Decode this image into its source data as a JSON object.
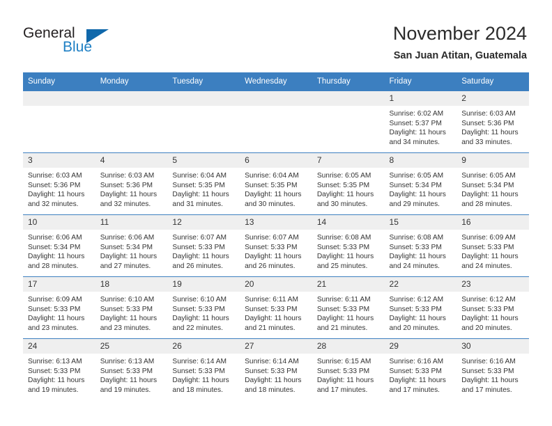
{
  "brand": {
    "name_part1": "General",
    "name_part2": "Blue",
    "flag_icon": "triangle-flag-icon"
  },
  "header": {
    "title": "November 2024",
    "subtitle": "San Juan Atitan, Guatemala"
  },
  "colors": {
    "header_blue": "#3c7fc0",
    "brand_blue": "#1d7fc4",
    "daynum_bg": "#efefef"
  },
  "calendar": {
    "weekday_headers": [
      "Sunday",
      "Monday",
      "Tuesday",
      "Wednesday",
      "Thursday",
      "Friday",
      "Saturday"
    ],
    "weeks": [
      [
        {
          "day": "",
          "empty": true,
          "sunrise": "",
          "sunset": "",
          "daylight1": "",
          "daylight2": ""
        },
        {
          "day": "",
          "empty": true,
          "sunrise": "",
          "sunset": "",
          "daylight1": "",
          "daylight2": ""
        },
        {
          "day": "",
          "empty": true,
          "sunrise": "",
          "sunset": "",
          "daylight1": "",
          "daylight2": ""
        },
        {
          "day": "",
          "empty": true,
          "sunrise": "",
          "sunset": "",
          "daylight1": "",
          "daylight2": ""
        },
        {
          "day": "",
          "empty": true,
          "sunrise": "",
          "sunset": "",
          "daylight1": "",
          "daylight2": ""
        },
        {
          "day": "1",
          "empty": false,
          "sunrise": "Sunrise: 6:02 AM",
          "sunset": "Sunset: 5:37 PM",
          "daylight1": "Daylight: 11 hours",
          "daylight2": "and 34 minutes."
        },
        {
          "day": "2",
          "empty": false,
          "sunrise": "Sunrise: 6:03 AM",
          "sunset": "Sunset: 5:36 PM",
          "daylight1": "Daylight: 11 hours",
          "daylight2": "and 33 minutes."
        }
      ],
      [
        {
          "day": "3",
          "empty": false,
          "sunrise": "Sunrise: 6:03 AM",
          "sunset": "Sunset: 5:36 PM",
          "daylight1": "Daylight: 11 hours",
          "daylight2": "and 32 minutes."
        },
        {
          "day": "4",
          "empty": false,
          "sunrise": "Sunrise: 6:03 AM",
          "sunset": "Sunset: 5:36 PM",
          "daylight1": "Daylight: 11 hours",
          "daylight2": "and 32 minutes."
        },
        {
          "day": "5",
          "empty": false,
          "sunrise": "Sunrise: 6:04 AM",
          "sunset": "Sunset: 5:35 PM",
          "daylight1": "Daylight: 11 hours",
          "daylight2": "and 31 minutes."
        },
        {
          "day": "6",
          "empty": false,
          "sunrise": "Sunrise: 6:04 AM",
          "sunset": "Sunset: 5:35 PM",
          "daylight1": "Daylight: 11 hours",
          "daylight2": "and 30 minutes."
        },
        {
          "day": "7",
          "empty": false,
          "sunrise": "Sunrise: 6:05 AM",
          "sunset": "Sunset: 5:35 PM",
          "daylight1": "Daylight: 11 hours",
          "daylight2": "and 30 minutes."
        },
        {
          "day": "8",
          "empty": false,
          "sunrise": "Sunrise: 6:05 AM",
          "sunset": "Sunset: 5:34 PM",
          "daylight1": "Daylight: 11 hours",
          "daylight2": "and 29 minutes."
        },
        {
          "day": "9",
          "empty": false,
          "sunrise": "Sunrise: 6:05 AM",
          "sunset": "Sunset: 5:34 PM",
          "daylight1": "Daylight: 11 hours",
          "daylight2": "and 28 minutes."
        }
      ],
      [
        {
          "day": "10",
          "empty": false,
          "sunrise": "Sunrise: 6:06 AM",
          "sunset": "Sunset: 5:34 PM",
          "daylight1": "Daylight: 11 hours",
          "daylight2": "and 28 minutes."
        },
        {
          "day": "11",
          "empty": false,
          "sunrise": "Sunrise: 6:06 AM",
          "sunset": "Sunset: 5:34 PM",
          "daylight1": "Daylight: 11 hours",
          "daylight2": "and 27 minutes."
        },
        {
          "day": "12",
          "empty": false,
          "sunrise": "Sunrise: 6:07 AM",
          "sunset": "Sunset: 5:33 PM",
          "daylight1": "Daylight: 11 hours",
          "daylight2": "and 26 minutes."
        },
        {
          "day": "13",
          "empty": false,
          "sunrise": "Sunrise: 6:07 AM",
          "sunset": "Sunset: 5:33 PM",
          "daylight1": "Daylight: 11 hours",
          "daylight2": "and 26 minutes."
        },
        {
          "day": "14",
          "empty": false,
          "sunrise": "Sunrise: 6:08 AM",
          "sunset": "Sunset: 5:33 PM",
          "daylight1": "Daylight: 11 hours",
          "daylight2": "and 25 minutes."
        },
        {
          "day": "15",
          "empty": false,
          "sunrise": "Sunrise: 6:08 AM",
          "sunset": "Sunset: 5:33 PM",
          "daylight1": "Daylight: 11 hours",
          "daylight2": "and 24 minutes."
        },
        {
          "day": "16",
          "empty": false,
          "sunrise": "Sunrise: 6:09 AM",
          "sunset": "Sunset: 5:33 PM",
          "daylight1": "Daylight: 11 hours",
          "daylight2": "and 24 minutes."
        }
      ],
      [
        {
          "day": "17",
          "empty": false,
          "sunrise": "Sunrise: 6:09 AM",
          "sunset": "Sunset: 5:33 PM",
          "daylight1": "Daylight: 11 hours",
          "daylight2": "and 23 minutes."
        },
        {
          "day": "18",
          "empty": false,
          "sunrise": "Sunrise: 6:10 AM",
          "sunset": "Sunset: 5:33 PM",
          "daylight1": "Daylight: 11 hours",
          "daylight2": "and 23 minutes."
        },
        {
          "day": "19",
          "empty": false,
          "sunrise": "Sunrise: 6:10 AM",
          "sunset": "Sunset: 5:33 PM",
          "daylight1": "Daylight: 11 hours",
          "daylight2": "and 22 minutes."
        },
        {
          "day": "20",
          "empty": false,
          "sunrise": "Sunrise: 6:11 AM",
          "sunset": "Sunset: 5:33 PM",
          "daylight1": "Daylight: 11 hours",
          "daylight2": "and 21 minutes."
        },
        {
          "day": "21",
          "empty": false,
          "sunrise": "Sunrise: 6:11 AM",
          "sunset": "Sunset: 5:33 PM",
          "daylight1": "Daylight: 11 hours",
          "daylight2": "and 21 minutes."
        },
        {
          "day": "22",
          "empty": false,
          "sunrise": "Sunrise: 6:12 AM",
          "sunset": "Sunset: 5:33 PM",
          "daylight1": "Daylight: 11 hours",
          "daylight2": "and 20 minutes."
        },
        {
          "day": "23",
          "empty": false,
          "sunrise": "Sunrise: 6:12 AM",
          "sunset": "Sunset: 5:33 PM",
          "daylight1": "Daylight: 11 hours",
          "daylight2": "and 20 minutes."
        }
      ],
      [
        {
          "day": "24",
          "empty": false,
          "sunrise": "Sunrise: 6:13 AM",
          "sunset": "Sunset: 5:33 PM",
          "daylight1": "Daylight: 11 hours",
          "daylight2": "and 19 minutes."
        },
        {
          "day": "25",
          "empty": false,
          "sunrise": "Sunrise: 6:13 AM",
          "sunset": "Sunset: 5:33 PM",
          "daylight1": "Daylight: 11 hours",
          "daylight2": "and 19 minutes."
        },
        {
          "day": "26",
          "empty": false,
          "sunrise": "Sunrise: 6:14 AM",
          "sunset": "Sunset: 5:33 PM",
          "daylight1": "Daylight: 11 hours",
          "daylight2": "and 18 minutes."
        },
        {
          "day": "27",
          "empty": false,
          "sunrise": "Sunrise: 6:14 AM",
          "sunset": "Sunset: 5:33 PM",
          "daylight1": "Daylight: 11 hours",
          "daylight2": "and 18 minutes."
        },
        {
          "day": "28",
          "empty": false,
          "sunrise": "Sunrise: 6:15 AM",
          "sunset": "Sunset: 5:33 PM",
          "daylight1": "Daylight: 11 hours",
          "daylight2": "and 17 minutes."
        },
        {
          "day": "29",
          "empty": false,
          "sunrise": "Sunrise: 6:16 AM",
          "sunset": "Sunset: 5:33 PM",
          "daylight1": "Daylight: 11 hours",
          "daylight2": "and 17 minutes."
        },
        {
          "day": "30",
          "empty": false,
          "sunrise": "Sunrise: 6:16 AM",
          "sunset": "Sunset: 5:33 PM",
          "daylight1": "Daylight: 11 hours",
          "daylight2": "and 17 minutes."
        }
      ]
    ]
  }
}
